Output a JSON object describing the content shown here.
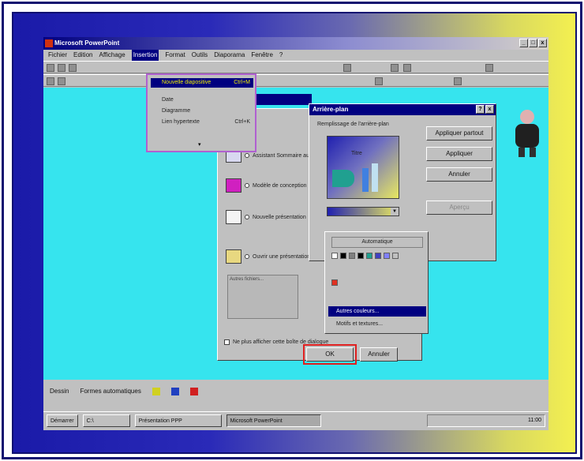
{
  "app": {
    "title": "Microsoft PowerPoint",
    "win_buttons": [
      "_",
      "□",
      "x"
    ]
  },
  "menubar": {
    "items": [
      {
        "label": "Fichier",
        "active": false
      },
      {
        "label": "Edition",
        "active": false
      },
      {
        "label": "Affichage",
        "active": false
      },
      {
        "label": "Insertion",
        "active": true
      },
      {
        "label": "Format",
        "active": false
      },
      {
        "label": "Outils",
        "active": false
      },
      {
        "label": "Diaporama",
        "active": false
      },
      {
        "label": "Fenêtre",
        "active": false
      },
      {
        "label": "?",
        "active": false
      }
    ]
  },
  "insert_menu": {
    "items": [
      {
        "label": "Nouvelle diapositive",
        "shortcut": "Ctrl+M",
        "selected": true
      },
      {
        "label": "Date",
        "shortcut": "",
        "selected": false
      },
      {
        "label": "Diagramme",
        "shortcut": "",
        "selected": false
      },
      {
        "label": "Lien hypertexte",
        "shortcut": "Ctrl+K",
        "selected": false
      }
    ]
  },
  "background_dialog": {
    "title": "Arrière-plan",
    "group_label": "Remplissage de l'arrière-plan",
    "preview_title": "Titre",
    "apply_all": "Appliquer partout",
    "apply": "Appliquer",
    "cancel": "Annuler",
    "preview_btn": "Aperçu"
  },
  "color_popup": {
    "automatic": "Automatique",
    "more_colors": "Autres couleurs...",
    "fill_effects": "Motifs et textures..."
  },
  "main_dialog": {
    "options": [
      {
        "label": "Assistant Sommaire automatique"
      },
      {
        "label": "Modèle de conception"
      },
      {
        "label": "Nouvelle présentation"
      },
      {
        "label": "Ouvrir une présentation existante"
      }
    ],
    "list_label": "Autres fichiers...",
    "checkbox_label": "Ne plus afficher cette boîte de dialogue",
    "ok": "OK",
    "cancel": "Annuler"
  },
  "drawbar": {
    "draw_label": "Dessin",
    "autoshapes_label": "Formes automatiques"
  },
  "taskbar": {
    "start": "Démarrer",
    "buttons": [
      {
        "label": "C:\\",
        "pressed": false
      },
      {
        "label": "Présentation PPP",
        "pressed": false
      },
      {
        "label": "Microsoft PowerPoint",
        "pressed": true
      }
    ],
    "clock": "11:00"
  },
  "colors": {
    "workspace": "#36e4ee",
    "title_bar": "#000080",
    "selection": "#000080",
    "ok_highlight": "#e02020",
    "menu_border": "#b060d0"
  },
  "swatch_colors": [
    "#ffffff",
    "#000000",
    "#808080",
    "#000000",
    "#20a090",
    "#4040c0",
    "#8080ff",
    "#c0c0c0"
  ]
}
